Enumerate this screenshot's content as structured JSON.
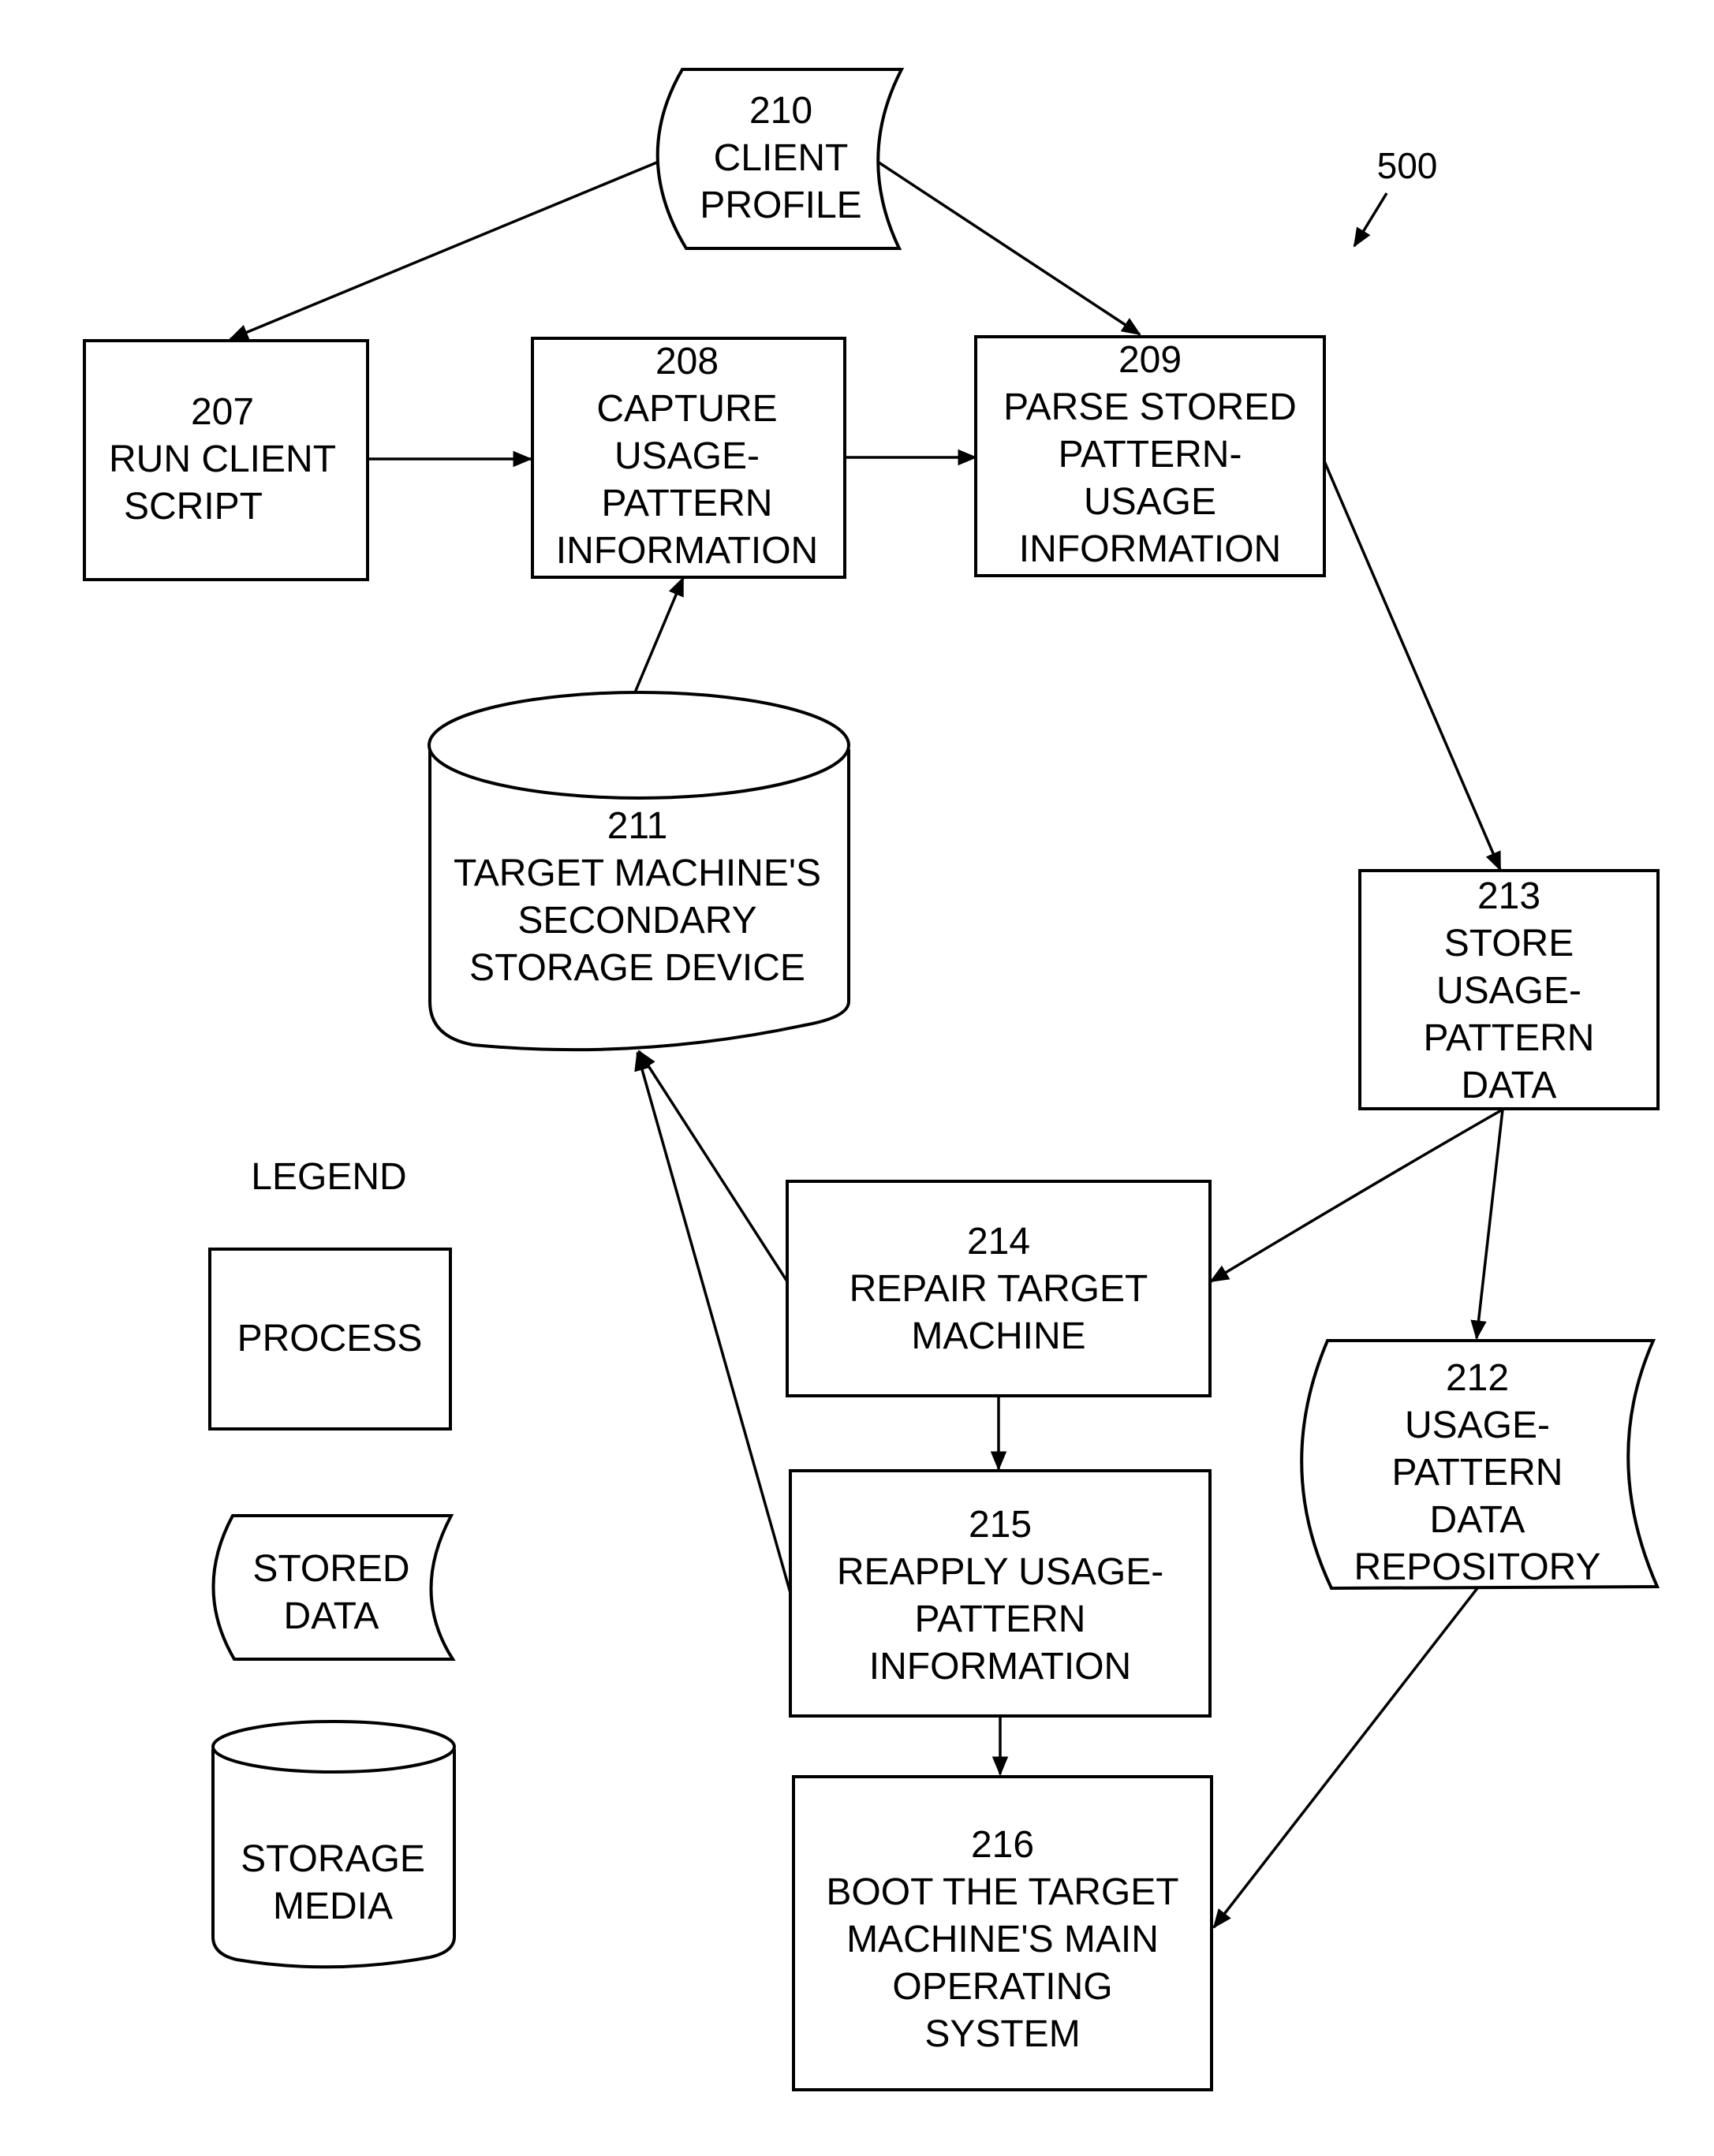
{
  "figure": {
    "reference_label": "500",
    "legend_title": "LEGEND"
  },
  "nodes": [
    {
      "id": "210",
      "type": "stored-data",
      "lines": [
        "210",
        "CLIENT",
        "PROFILE"
      ]
    },
    {
      "id": "207",
      "type": "process",
      "lines": [
        "207",
        "RUN CLIENT",
        "SCRIPT"
      ]
    },
    {
      "id": "208",
      "type": "process",
      "lines": [
        "208",
        "CAPTURE",
        "USAGE-",
        "PATTERN",
        "INFORMATION"
      ]
    },
    {
      "id": "209",
      "type": "process",
      "lines": [
        "209",
        "PARSE STORED",
        "PATTERN-",
        "USAGE",
        "INFORMATION"
      ]
    },
    {
      "id": "211",
      "type": "storage-media",
      "lines": [
        "211",
        "TARGET MACHINE'S",
        "SECONDARY",
        "STORAGE DEVICE"
      ]
    },
    {
      "id": "213",
      "type": "process",
      "lines": [
        "213",
        "STORE",
        "USAGE-",
        "PATTERN",
        "DATA"
      ]
    },
    {
      "id": "214",
      "type": "process",
      "lines": [
        "214",
        "REPAIR TARGET",
        "MACHINE"
      ]
    },
    {
      "id": "212",
      "type": "stored-data",
      "lines": [
        "212",
        "USAGE-",
        "PATTERN",
        "DATA",
        "REPOSITORY"
      ]
    },
    {
      "id": "215",
      "type": "process",
      "lines": [
        "215",
        "REAPPLY USAGE-",
        "PATTERN",
        "INFORMATION"
      ]
    },
    {
      "id": "216",
      "type": "process",
      "lines": [
        "216",
        "BOOT THE TARGET",
        "MACHINE'S MAIN",
        "OPERATING",
        "SYSTEM"
      ]
    }
  ],
  "edges": [
    {
      "from": "210",
      "to": "207"
    },
    {
      "from": "210",
      "to": "209"
    },
    {
      "from": "207",
      "to": "208"
    },
    {
      "from": "208",
      "to": "209"
    },
    {
      "from": "211",
      "to": "208"
    },
    {
      "from": "209",
      "to": "213"
    },
    {
      "from": "213",
      "to": "214"
    },
    {
      "from": "213",
      "to": "212"
    },
    {
      "from": "214",
      "to": "211"
    },
    {
      "from": "215",
      "to": "211"
    },
    {
      "from": "214",
      "to": "215"
    },
    {
      "from": "215",
      "to": "216"
    },
    {
      "from": "212",
      "to": "216"
    }
  ],
  "legend": [
    {
      "type": "process",
      "lines": [
        "PROCESS"
      ]
    },
    {
      "type": "stored-data",
      "lines": [
        "STORED",
        "DATA"
      ]
    },
    {
      "type": "storage-media",
      "lines": [
        "STORAGE",
        "MEDIA"
      ]
    }
  ]
}
